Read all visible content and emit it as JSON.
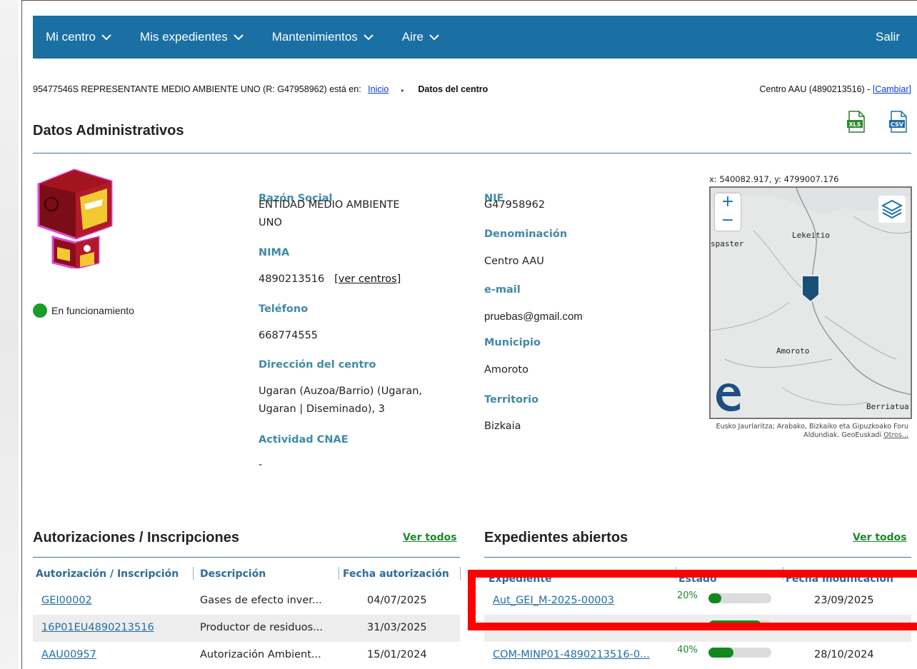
{
  "nav": {
    "items": [
      {
        "label": "Mi centro"
      },
      {
        "label": "Mis expedientes"
      },
      {
        "label": "Mantenimientos"
      },
      {
        "label": "Aire"
      }
    ],
    "logout": "Salir"
  },
  "breadcrumb": {
    "user": "95477546S REPRESENTANTE MEDIO AMBIENTE UNO (R: G47958962) está en:",
    "home": "Inicio",
    "current": "Datos del centro",
    "centre_text": "Centro AAU (4890213516) -",
    "change": "[Cambiar]"
  },
  "admin": {
    "title": "Datos Administrativos",
    "status": "En funcionamiento",
    "status_color": "#1a9d2b",
    "razon_social_label": "Razón Social",
    "razon_social_line1": "ENTIDAD MEDIO AMBIENTE",
    "razon_social_line2": "UNO",
    "nima_label": "NIMA",
    "nima_value": "4890213516",
    "nima_link": "[ver centros]",
    "telefono_label": "Teléfono",
    "telefono_value": "668774555",
    "direccion_label": "Dirección del centro",
    "direccion_line1": "Ugaran (Auzoa/Barrio) (Ugaran,",
    "direccion_line2": "Ugaran | Diseminado), 3",
    "cnae_label": "Actividad CNAE",
    "cnae_value": "-",
    "nif_label": "NIF",
    "nif_value": "G47958962",
    "denominacion_label": "Denominación",
    "denominacion_value": "Centro AAU",
    "email_label": "e-mail",
    "email_value": "pruebas@gmail.com",
    "municipio_label": "Municipio",
    "municipio_value": "Amoroto",
    "territorio_label": "Territorio",
    "territorio_value": "Bizkaia",
    "export_xls": "XLS",
    "export_csv": "CSV"
  },
  "map": {
    "coords": "x: 540082.917, y: 4799007.176",
    "zoom_in": "+",
    "zoom_out": "−",
    "labels": {
      "lekeitio": "Lekeitio",
      "ispaster": "spaster",
      "amoroto": "Amoroto",
      "berriatua": "Berriatua"
    },
    "attribution": "Eusko Jaurlaritza; Arabako, Bizkaiko eta Gipuzkoako Foru Aldundiak. GeoEuskadi",
    "attribution_link": "Otros..."
  },
  "autorizaciones": {
    "title": "Autorizaciones / Inscripciones",
    "ver_todos": "Ver todos",
    "columns": [
      "Autorización / Inscripción",
      "Descripción",
      "Fecha autorización"
    ],
    "rows": [
      {
        "code": "GEI00002",
        "desc": "Gases de efecto inver...",
        "date": "04/07/2025"
      },
      {
        "code": "16P01EU4890213516",
        "desc": "Productor de residuos...",
        "date": "31/03/2025"
      },
      {
        "code": "AAU00957",
        "desc": "Autorización Ambient...",
        "date": "15/01/2024"
      }
    ]
  },
  "expedientes": {
    "title": "Expedientes abiertos",
    "ver_todos": "Ver todos",
    "columns": [
      "Expediente",
      "Estado",
      "Fecha modificación"
    ],
    "rows": [
      {
        "code": "Aut_GEI_M-2025-00003",
        "pct_label": "20%",
        "pct": 0.2,
        "date": "23/09/2025"
      },
      {
        "code": "",
        "pct_label": "",
        "pct": 0.84,
        "date": ""
      },
      {
        "code": "COM-MINP01-4890213516-0...",
        "pct_label": "40%",
        "pct": 0.4,
        "date": "28/10/2024"
      }
    ]
  }
}
